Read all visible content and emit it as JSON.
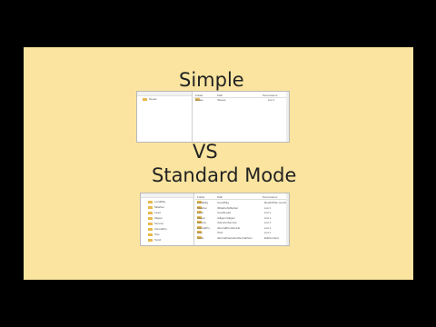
{
  "slide": {
    "heading_simple": "Simple",
    "heading_vs": "VS",
    "heading_standard": "Standard Mode"
  },
  "simple_shot": {
    "tree_items": [
      "Neues"
    ],
    "columns": [
      "Folder",
      "Path",
      "Permissions"
    ],
    "rows": [
      {
        "folder": "Neues",
        "path": "\\Neues",
        "perm": "List 1"
      }
    ]
  },
  "standard_shot": {
    "tree_items": [
      "LocalMig",
      "Mitarbei",
      "Lead",
      "Allgem",
      "Service",
      "ZentralPro",
      "Test",
      "Test2"
    ],
    "columns": [
      "Folder",
      "Path",
      "Permissions"
    ],
    "rows": [
      {
        "folder": "LocalMig",
        "path": "\\LocalMig",
        "perm": "Read/Write (Local)"
      },
      {
        "folder": "Mitarbei",
        "path": "\\Mitarbei\\Mitarbei",
        "perm": "List 1"
      },
      {
        "folder": "Lead",
        "path": "\\Lead\\Lead",
        "perm": "List 1"
      },
      {
        "folder": "Allgem",
        "path": "\\Allgem\\Allgem",
        "perm": "List 1"
      },
      {
        "folder": "Service",
        "path": "\\Service\\Service",
        "perm": "List 1"
      },
      {
        "folder": "ZentralPro",
        "path": "\\ZentralPro\\Zentral",
        "perm": "List 1"
      },
      {
        "folder": "Test",
        "path": "\\Test",
        "perm": "List 1"
      },
      {
        "folder": "Test2",
        "path": "\\Zentral\\Verteiler\\Zentral\\Test",
        "perm": "Edit/Limited"
      }
    ]
  }
}
